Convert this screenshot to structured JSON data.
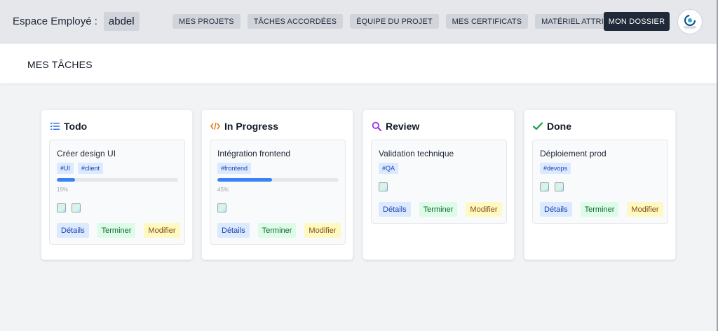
{
  "header": {
    "brand_label": "Espace Employé :",
    "user": "abdel",
    "nav": [
      "MES PROJETS",
      "TÂCHES ACCORDÉES",
      "ÉQUIPE DU PROJET",
      "MES CERTIFICATS",
      "MATÉRIEL ATTRIBUÉ"
    ],
    "dossier_label": "MON DOSSIER",
    "logo_icon": "company-logo-icon"
  },
  "page": {
    "title": "MES TÂCHES"
  },
  "columns": [
    {
      "title": "Todo",
      "icon": "checklist-icon",
      "icon_color": "#2563eb",
      "card": {
        "title": "Créer design UI",
        "tags": [
          "#UI",
          "#client"
        ],
        "progress": 15,
        "progress_label": "15%",
        "avatars": 2,
        "actions": {
          "details": "Détails",
          "finish": "Terminer",
          "edit": "Modifier"
        }
      }
    },
    {
      "title": "In Progress",
      "icon": "code-icon",
      "icon_color": "#d97706",
      "card": {
        "title": "Intégration frontend",
        "tags": [
          "#frontend"
        ],
        "progress": 45,
        "progress_label": "45%",
        "avatars": 1,
        "actions": {
          "details": "Détails",
          "finish": "Terminer",
          "edit": "Modifier"
        }
      }
    },
    {
      "title": "Review",
      "icon": "search-icon",
      "icon_color": "#9333ea",
      "card": {
        "title": "Validation technique",
        "tags": [
          "#QA"
        ],
        "avatars": 1,
        "actions": {
          "details": "Détails",
          "finish": "Terminer",
          "edit": "Modifier"
        }
      }
    },
    {
      "title": "Done",
      "icon": "check-icon",
      "icon_color": "#16a34a",
      "card": {
        "title": "Déploiement prod",
        "tags": [
          "#devops"
        ],
        "avatars": 2,
        "actions": {
          "details": "Détails",
          "finish": "Terminer",
          "edit": "Modifier"
        }
      }
    }
  ],
  "colors": {
    "header_bg": "#e5e7eb",
    "dossier_bg": "#1f2937",
    "progress": "#3b82f6"
  }
}
